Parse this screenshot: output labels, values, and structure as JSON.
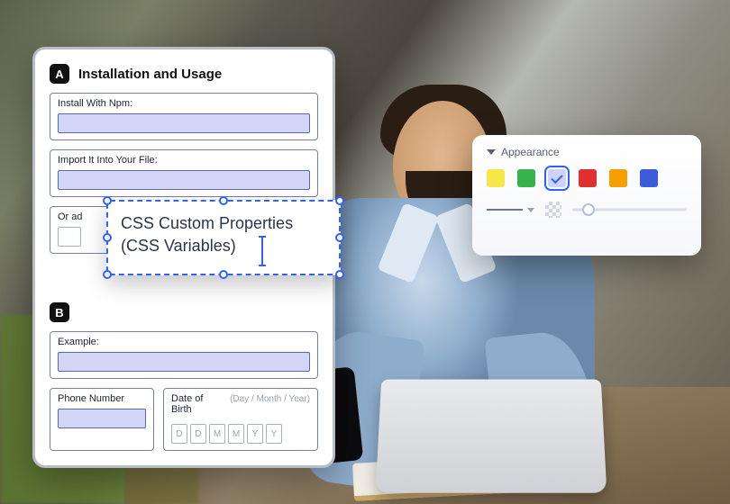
{
  "form": {
    "sectionA": {
      "badge": "A",
      "title": "Installation and Usage"
    },
    "installLabel": "Install With Npm:",
    "importLabel": "Import It Into Your File:",
    "orLabel": "Or ad",
    "sectionB": {
      "badge": "B"
    },
    "exampleLabel": "Example:",
    "phoneLabel": "Phone Number",
    "dobLabel": "Date of Birth",
    "dobHint": "(Day / Month / Year)",
    "dobPlaceholders": [
      "D",
      "D",
      "M",
      "M",
      "Y",
      "Y"
    ]
  },
  "floating": {
    "line1": "CSS Custom Properties",
    "line2": "(CSS Variables)"
  },
  "appearance": {
    "title": "Appearance",
    "swatches": [
      {
        "name": "yellow",
        "color": "#f6e84a",
        "checked": false
      },
      {
        "name": "green",
        "color": "#37b24d",
        "checked": false
      },
      {
        "name": "lilac",
        "color": "#cfd2ff",
        "checked": true
      },
      {
        "name": "red",
        "color": "#e03131",
        "checked": false
      },
      {
        "name": "orange",
        "color": "#f59f00",
        "checked": false
      },
      {
        "name": "blue",
        "color": "#3b5bdb",
        "checked": false
      }
    ]
  }
}
